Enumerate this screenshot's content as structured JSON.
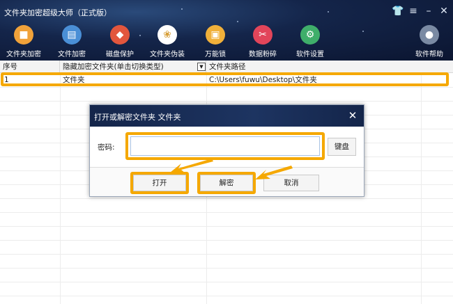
{
  "app": {
    "title": "文件夹加密超级大师（正式版）",
    "window_controls": [
      "skin-icon",
      "menu-icon",
      "minimize-icon",
      "close-icon"
    ]
  },
  "toolbar": {
    "items": [
      {
        "label": "文件夹加密",
        "icon": "folder-lock-icon",
        "color": "#f0a23a"
      },
      {
        "label": "文件加密",
        "icon": "file-lock-icon",
        "color": "#4a8fd6"
      },
      {
        "label": "磁盘保护",
        "icon": "shield-icon",
        "color": "#e2563d"
      },
      {
        "label": "文件夹伪装",
        "icon": "palette-icon",
        "color": "#d8a03a"
      },
      {
        "label": "万能锁",
        "icon": "padlock-icon",
        "color": "#f0b03a"
      },
      {
        "label": "数据粉碎",
        "icon": "scissors-icon",
        "color": "#e2455a"
      },
      {
        "label": "软件设置",
        "icon": "gear-icon",
        "color": "#3fae6a"
      },
      {
        "label": "软件帮助",
        "icon": "user-help-icon",
        "color": "#7a8aa3"
      }
    ]
  },
  "table": {
    "columns": [
      "序号",
      "隐藏加密文件夹(单击切换类型)",
      "文件夹路径"
    ],
    "rows": [
      {
        "index": "1",
        "type": "文件夹",
        "path": "C:\\Users\\fuwu\\Desktop\\文件夹"
      }
    ],
    "sort_icon": "dropdown-arrow-icon"
  },
  "dialog": {
    "title": "打开或解密文件夹 文件夹",
    "password_label": "密码:",
    "password_value": "",
    "keyboard_button": "键盘",
    "open_button": "打开",
    "decrypt_button": "解密",
    "cancel_button": "取消"
  },
  "highlight_color": "#f5a800"
}
